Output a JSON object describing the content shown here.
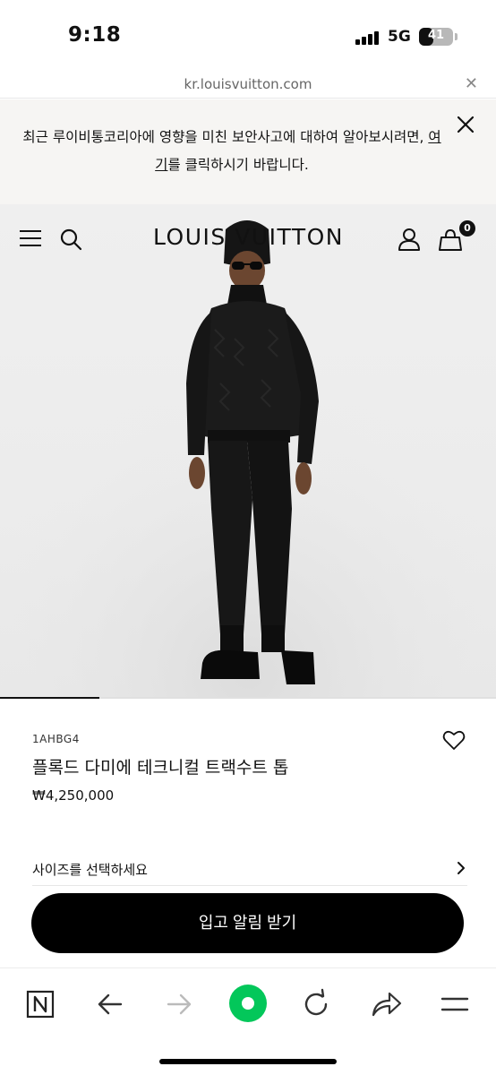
{
  "status_bar": {
    "time": "9:18",
    "network": "5G",
    "battery_level": "41",
    "battery_fraction": 0.41
  },
  "url_bar": {
    "url": "kr.louisvuitton.com",
    "close_icon": "close-icon"
  },
  "banner": {
    "text_before_link": "최근 루이비통코리아에 영향을 미친 보안사고에 대하여 알아보시려면, ",
    "link_text": "여기",
    "text_after_link": "를 클릭하시기 바랍니다."
  },
  "header": {
    "brand": "LOUIS VUITTON",
    "menu_icon": "menu-icon",
    "search_icon": "search-icon",
    "account_icon": "account-icon",
    "bag_icon": "shopping-bag-icon",
    "bag_count": "0"
  },
  "hero": {
    "image": "model-wearing-black-tracksuit",
    "carousel_progress": 0.2
  },
  "product": {
    "sku": "1AHBG4",
    "name": "플록드 다미에 테크니컬 트랙수트 톱",
    "price": "₩4,250,000",
    "wishlist_icon": "heart-icon",
    "size_prompt": "사이즈를 선택하세요",
    "size_chevron_icon": "chevron-right-icon"
  },
  "cta": {
    "label": "입고 알림 받기"
  },
  "browser_toolbar": {
    "items": [
      "naver-home-icon",
      "back-arrow-icon",
      "forward-arrow-icon",
      "green-home-button-icon",
      "reload-icon",
      "share-icon",
      "menu-icon"
    ],
    "accent_color": "#03c75a"
  },
  "colors": {
    "banner_bg": "#f6f5f3",
    "cta_bg": "#000000",
    "hero_bg": "#ececec"
  }
}
